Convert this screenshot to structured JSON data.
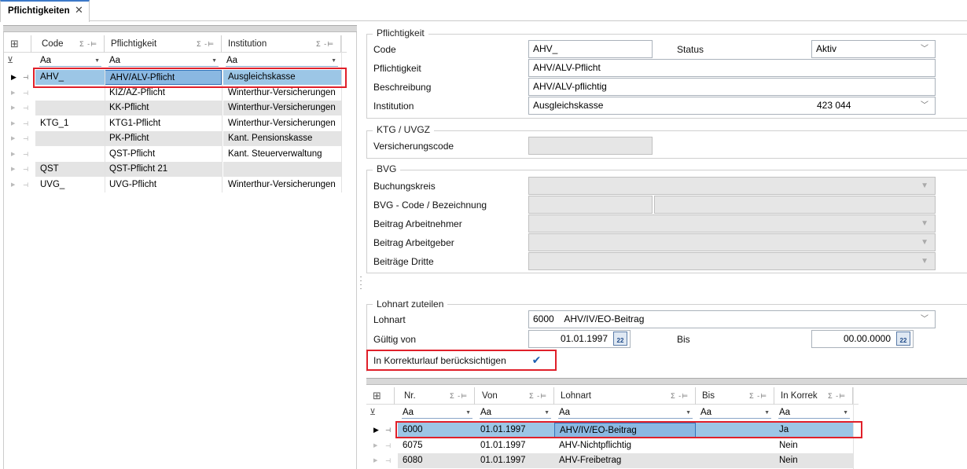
{
  "tab": {
    "title": "Pflichtigkeiten"
  },
  "left_grid": {
    "columns": [
      {
        "label": "Code",
        "sigma": "Σ -⊨"
      },
      {
        "label": "Pflichtigkeit",
        "sigma": "Σ -⊨"
      },
      {
        "label": "Institution",
        "sigma": "Σ -⊨"
      }
    ],
    "filter": "Aa",
    "rows": [
      {
        "code": "AHV_",
        "pflicht": "AHV/ALV-Pflicht",
        "inst": "Ausgleichskasse"
      },
      {
        "code": "",
        "pflicht": "KIZ/AZ-Pflicht",
        "inst": "Winterthur-Versicherungen"
      },
      {
        "code": "",
        "pflicht": "KK-Pflicht",
        "inst": "Winterthur-Versicherungen"
      },
      {
        "code": "KTG_1",
        "pflicht": "KTG1-Pflicht",
        "inst": "Winterthur-Versicherungen"
      },
      {
        "code": "",
        "pflicht": "PK-Pflicht",
        "inst": "Kant. Pensionskasse"
      },
      {
        "code": "",
        "pflicht": "QST-Pflicht",
        "inst": "Kant. Steuerverwaltung"
      },
      {
        "code": "QST",
        "pflicht": "QST-Pflicht 21",
        "inst": ""
      },
      {
        "code": "UVG_",
        "pflicht": "UVG-Pflicht",
        "inst": "Winterthur-Versicherungen"
      }
    ]
  },
  "form": {
    "pflichtigkeit": {
      "title": "Pflichtigkeit",
      "code_label": "Code",
      "code_value": "AHV_",
      "status_label": "Status",
      "status_value": "Aktiv",
      "pflicht_label": "Pflichtigkeit",
      "pflicht_value": "AHV/ALV-Pflicht",
      "beschr_label": "Beschreibung",
      "beschr_value": "AHV/ALV-pflichtig",
      "inst_label": "Institution",
      "inst_value": "Ausgleichskasse",
      "inst_number": "423 044"
    },
    "ktg": {
      "title": "KTG / UVGZ",
      "vcode_label": "Versicherungscode"
    },
    "bvg": {
      "title": "BVG",
      "buchungskreis": "Buchungskreis",
      "code_bez": "BVG - Code / Bezeichnung",
      "beitrag_an": "Beitrag Arbeitnehmer",
      "beitrag_ag": "Beitrag Arbeitgeber",
      "beitraege_dritte": "Beiträge Dritte"
    },
    "lohnart": {
      "title": "Lohnart zuteilen",
      "lohnart_label": "Lohnart",
      "lohnart_value": "6000    AHV/IV/EO-Beitrag",
      "gueltig_label": "Gültig von",
      "gueltig_value": "01.01.1997",
      "bis_label": "Bis",
      "bis_value": "00.00.0000",
      "cal_text": "22",
      "korrektur_label": "In Korrekturlauf berücksichtigen",
      "korrektur_checked": true
    }
  },
  "bottom_grid": {
    "columns": [
      {
        "label": "Nr.",
        "sigma": "Σ -⊨"
      },
      {
        "label": "Von",
        "sigma": "Σ -⊨"
      },
      {
        "label": "Lohnart",
        "sigma": "Σ -⊨"
      },
      {
        "label": "Bis",
        "sigma": "Σ -⊨"
      },
      {
        "label": "In Korrek",
        "sigma": "Σ -⊨"
      }
    ],
    "filter": "Aa",
    "rows": [
      {
        "nr": "6000",
        "von": "01.01.1997",
        "lohnart": "AHV/IV/EO-Beitrag",
        "bis": "",
        "korrek": "Ja"
      },
      {
        "nr": "6075",
        "von": "01.01.1997",
        "lohnart": "AHV-Nichtpflichtig",
        "bis": "",
        "korrek": "Nein"
      },
      {
        "nr": "6080",
        "von": "01.01.1997",
        "lohnart": "AHV-Freibetrag",
        "bis": "",
        "korrek": "Nein"
      }
    ]
  },
  "colors": {
    "selection": "#9cc6e6",
    "highlight_box": "#e0202a",
    "tab_accent": "#3c78c8"
  }
}
